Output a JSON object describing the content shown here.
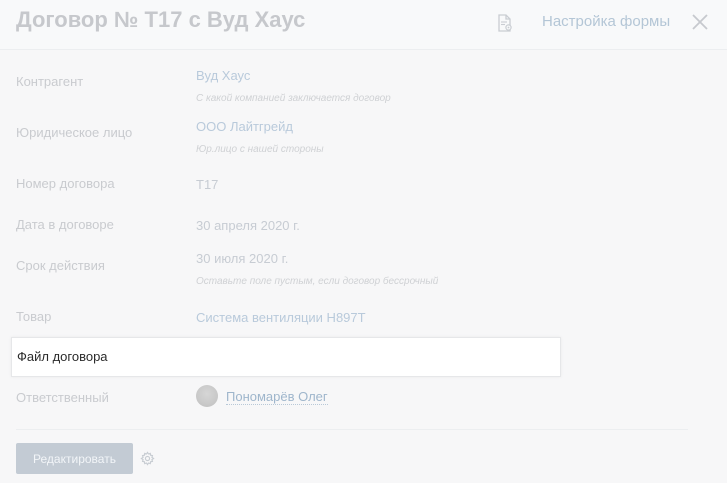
{
  "header": {
    "title": "Договор № Т17 с Вуд Хаус",
    "form_settings_label": "Настройка формы",
    "doc_icon": "document-settings-icon",
    "close_icon": "close-icon"
  },
  "fields": {
    "counterparty": {
      "label": "Контрагент",
      "value": "Вуд Хаус",
      "hint": "С какой компанией заключается договор"
    },
    "legal_entity": {
      "label": "Юридическое лицо",
      "value": "ООО Лайтгрейд",
      "hint": "Юр.лицо с нашей стороны"
    },
    "contract_number": {
      "label": "Номер договора",
      "value": "Т17"
    },
    "contract_date": {
      "label": "Дата в договоре",
      "value": "30 апреля 2020 г."
    },
    "validity": {
      "label": "Срок действия",
      "value": "30 июля 2020 г.",
      "hint": "Оставьте поле пустым, если договор бессрочный"
    },
    "product": {
      "label": "Товар",
      "value": "Система вентиляции Н897Т"
    },
    "contract_file": {
      "label": "Файл договора"
    },
    "responsible": {
      "label": "Ответственный",
      "value": "Пономарёв Олег"
    }
  },
  "footer": {
    "edit_label": "Редактировать",
    "settings_icon": "gear-icon"
  },
  "colors": {
    "highlight_background": "#ffffff",
    "edit_button": "#c3cbd4",
    "link": "#b9cadb"
  }
}
